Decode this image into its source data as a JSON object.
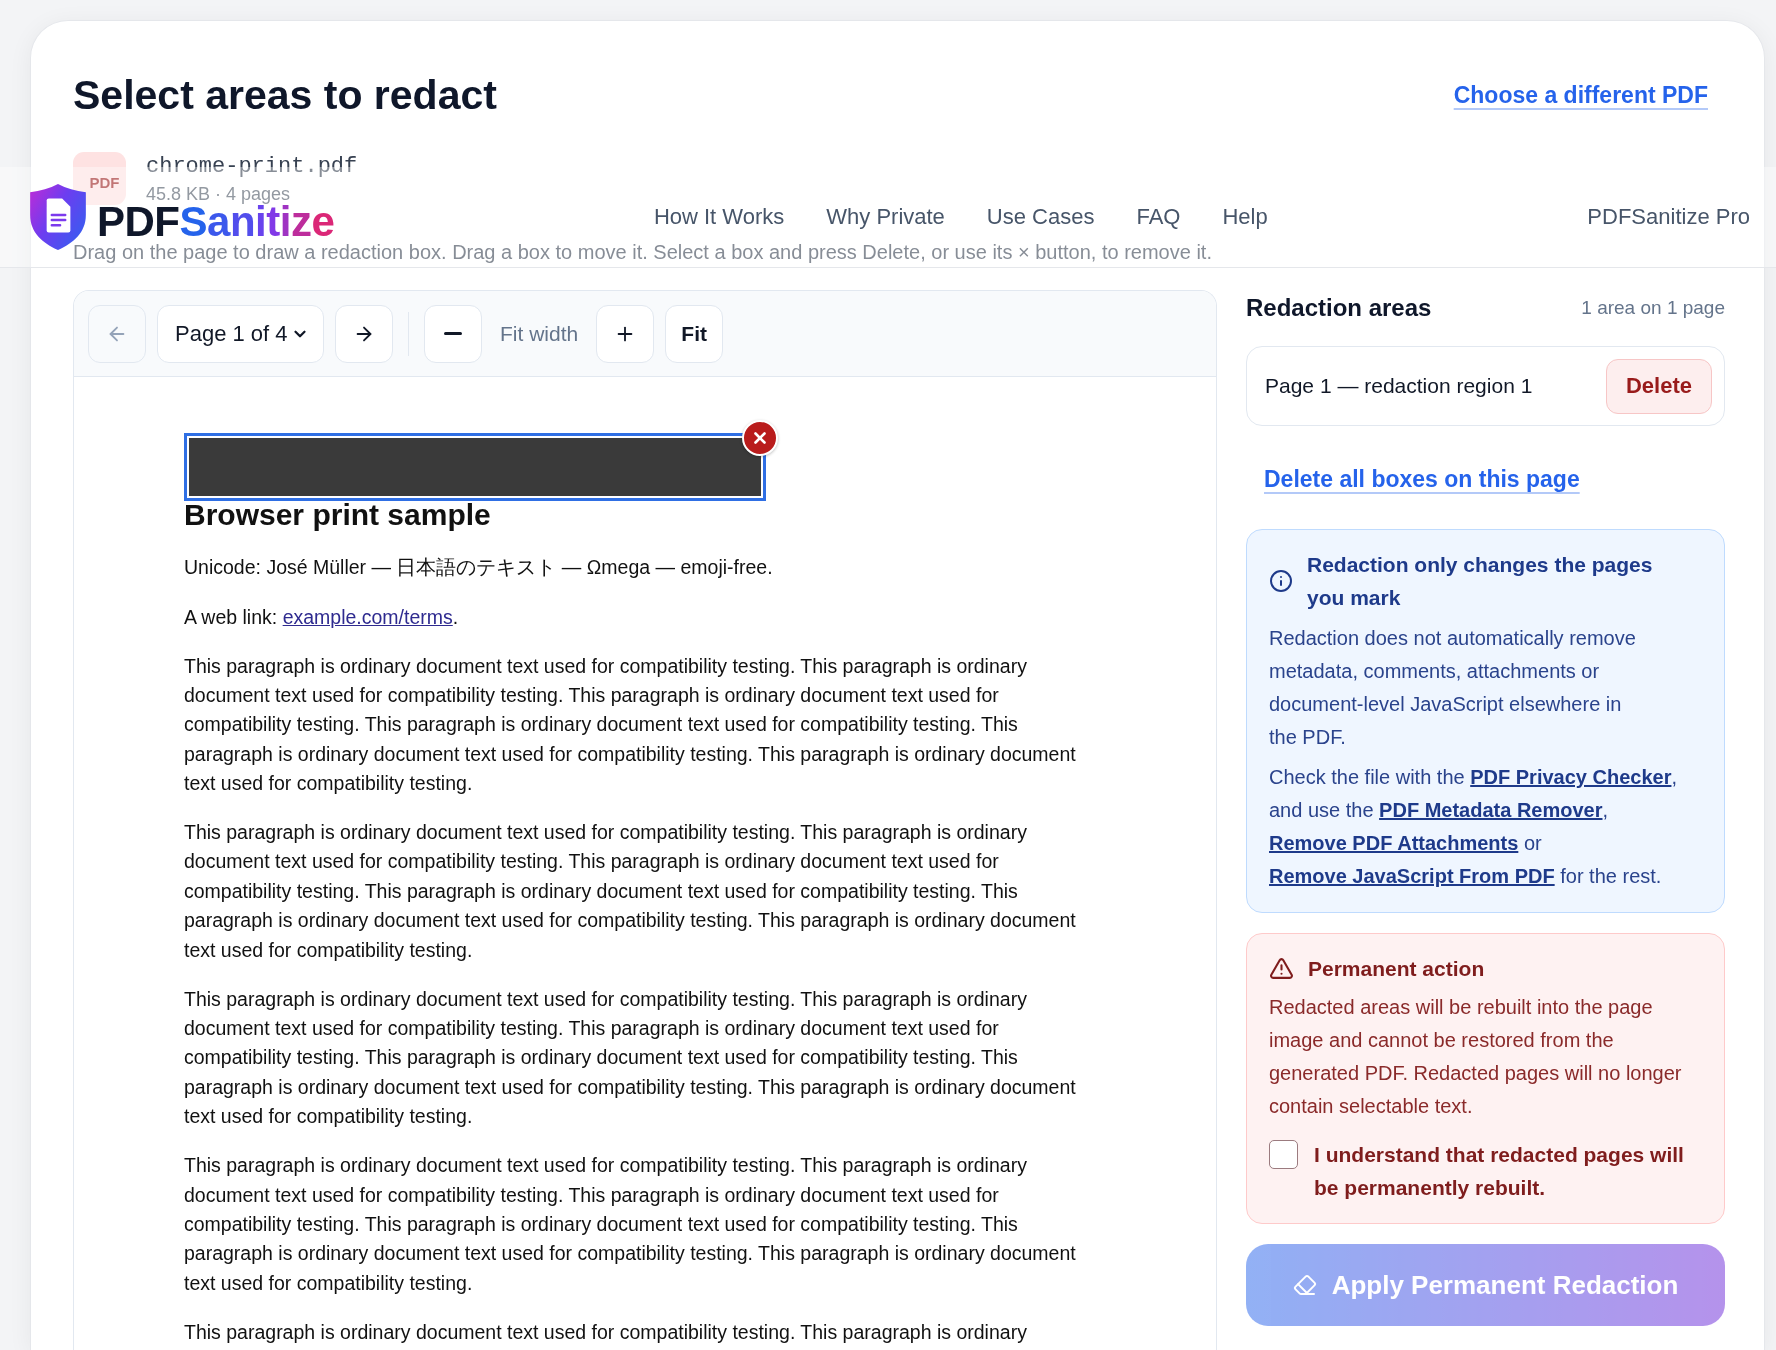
{
  "header": {
    "title": "Select areas to redact",
    "change_link": "Choose a different PDF"
  },
  "file": {
    "type_label": "PDF",
    "name": "chrome-print.pdf",
    "meta": "45.8 KB · 4 pages"
  },
  "site_header": {
    "brand": {
      "lead": "PDF",
      "accent": "Sanitize"
    },
    "links": [
      "How It Works",
      "Why Private",
      "Use Cases",
      "FAQ",
      "Help"
    ],
    "pro_link": "PDFSanitize Pro"
  },
  "instructions": "Drag on the page to draw a redaction box. Drag a box to move it. Select a box and press Delete, or use its × button, to remove it.",
  "toolbar": {
    "prev_page": {
      "disabled": true
    },
    "page_select": "Page 1 of 4",
    "next_page": {
      "disabled": false
    },
    "zoom_level": "Fit width",
    "fit_button": "Fit"
  },
  "redactions": [
    {
      "selected": true
    }
  ],
  "document": {
    "heading": "Browser print sample",
    "unicode_line": "Unicode: José Müller — 日本語のテキスト — Ωmega — emoji-free.",
    "link_line": {
      "before": "A web link: ",
      "link": "example.com/terms",
      "after": "."
    },
    "paragraphs": [
      "This paragraph is ordinary document text used for compatibility testing. This paragraph is ordinary document text used for compatibility testing. This paragraph is ordinary document text used for compatibility testing. This paragraph is ordinary document text used for compatibility testing. This paragraph is ordinary document text used for compatibility testing. This paragraph is ordinary document text used for compatibility testing.",
      "This paragraph is ordinary document text used for compatibility testing. This paragraph is ordinary document text used for compatibility testing. This paragraph is ordinary document text used for compatibility testing. This paragraph is ordinary document text used for compatibility testing. This paragraph is ordinary document text used for compatibility testing. This paragraph is ordinary document text used for compatibility testing.",
      "This paragraph is ordinary document text used for compatibility testing. This paragraph is ordinary document text used for compatibility testing. This paragraph is ordinary document text used for compatibility testing. This paragraph is ordinary document text used for compatibility testing. This paragraph is ordinary document text used for compatibility testing. This paragraph is ordinary document text used for compatibility testing.",
      "This paragraph is ordinary document text used for compatibility testing. This paragraph is ordinary document text used for compatibility testing. This paragraph is ordinary document text used for compatibility testing. This paragraph is ordinary document text used for compatibility testing. This paragraph is ordinary document text used for compatibility testing. This paragraph is ordinary document text used for compatibility testing.",
      "This paragraph is ordinary document text used for compatibility testing. This paragraph is ordinary"
    ]
  },
  "areas_panel": {
    "title": "Redaction areas",
    "summary": "1 area on 1 page",
    "regions": [
      {
        "label": "Page 1 — redaction region 1",
        "action": "Delete"
      }
    ],
    "delete_all": "Delete all boxes on this page"
  },
  "info_note": {
    "title": "Redaction only changes the pages you mark",
    "body": "Redaction does not automatically remove metadata, comments, attachments or document-level JavaScript elsewhere in the PDF.",
    "links_sentence": [
      {
        "kind": "text",
        "text": "Check the file with the "
      },
      {
        "kind": "link",
        "text": "PDF Privacy Checker"
      },
      {
        "kind": "text",
        "text": ", and use the "
      },
      {
        "kind": "link",
        "text": "PDF Metadata Remover"
      },
      {
        "kind": "text",
        "text": ", "
      },
      {
        "kind": "link",
        "text": "Remove PDF Attachments"
      },
      {
        "kind": "text",
        "text": " or "
      },
      {
        "kind": "link",
        "text": "Remove JavaScript From PDF"
      },
      {
        "kind": "text",
        "text": " for the rest."
      }
    ]
  },
  "warning": {
    "title": "Permanent action",
    "body": "Redacted areas will be rebuilt into the page image and cannot be restored from the generated PDF. Redacted pages will no longer contain selectable text.",
    "confirm": {
      "label": "I understand that redacted pages will be permanently rebuilt.",
      "checked": false
    }
  },
  "apply_button": {
    "label": "Apply Permanent Redaction",
    "disabled": true
  }
}
